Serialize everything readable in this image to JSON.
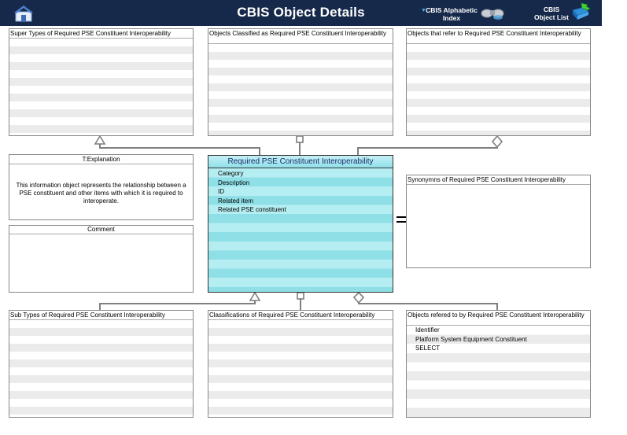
{
  "header": {
    "title": "CBIS Object Details",
    "alpha_index_line1": "CBIS Alphabetic",
    "alpha_index_line2": "Index",
    "object_list_line1": "CBIS",
    "object_list_line2": "Object List"
  },
  "colors": {
    "header_bg": "#16294a",
    "center_fill": "#8fe0ea",
    "connector": "#7f7f7f"
  },
  "supertypes": {
    "prefix": "Super Types of",
    "name": "Required PSE Constituent Interoperability"
  },
  "classified": {
    "prefix": "Objects Classified as",
    "name": "Required PSE Constituent Interoperability"
  },
  "refer_to": {
    "prefix": "Objects that refer to",
    "name": "Required PSE Constituent Interoperability"
  },
  "explanation": {
    "title": "T:Explanation",
    "text": "This information object represents the relationship between a PSE constituent and other items with which it is required to interoperate."
  },
  "comment": {
    "title": "Comment"
  },
  "center": {
    "title": "Required PSE Constituent Interoperability",
    "attributes": [
      "Category",
      "Description",
      "ID",
      "Related item",
      "Related PSE constituent"
    ]
  },
  "synonyms": {
    "prefix": "Synonymns   of",
    "name": "Required PSE Constituent Interoperability"
  },
  "subtypes": {
    "prefix": "Sub Types of",
    "name": "Required PSE Constituent Interoperability"
  },
  "classifications": {
    "prefix": "Classifications of",
    "name": "Required PSE Constituent Interoperability"
  },
  "referred_by": {
    "prefix": "Objects refered to by",
    "name": "Required PSE Constituent Interoperability",
    "items": [
      "Identifier",
      "Platform System Equipment Constituent",
      "SELECT"
    ]
  }
}
